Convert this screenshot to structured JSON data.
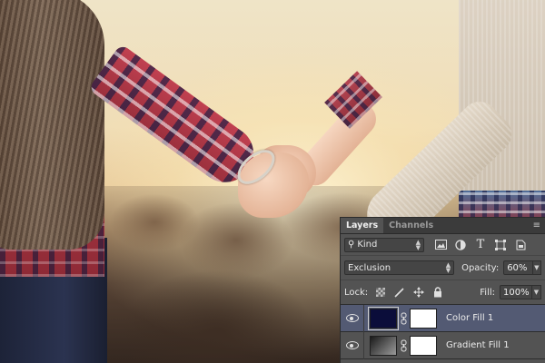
{
  "panel": {
    "tabs": [
      {
        "label": "Layers",
        "active": true
      },
      {
        "label": "Channels",
        "active": false
      }
    ],
    "filter": {
      "search_glyph": "⚲",
      "kind_label": "Kind",
      "icons": [
        "image-icon",
        "adjustment-icon",
        "type-icon",
        "shape-icon",
        "smart-object-icon"
      ],
      "type_glyph": "T"
    },
    "blend": {
      "mode": "Exclusion",
      "opacity_label": "Opacity:",
      "opacity_value": "60%"
    },
    "lock": {
      "label": "Lock:",
      "icons": [
        "lock-transparent-pixels-icon",
        "lock-image-pixels-icon",
        "lock-position-icon",
        "lock-all-icon"
      ],
      "fill_label": "Fill:",
      "fill_value": "100%"
    },
    "layers": [
      {
        "name": "Color Fill 1",
        "selected": true,
        "thumb_color": "#0b0d3a",
        "visible": true
      },
      {
        "name": "Gradient Fill 1",
        "selected": false,
        "thumb": "gradient",
        "visible": true
      }
    ],
    "colors": {
      "panel_bg": "#535353",
      "selected_row": "#535a73",
      "fill_color": "#0b0d3a"
    }
  }
}
